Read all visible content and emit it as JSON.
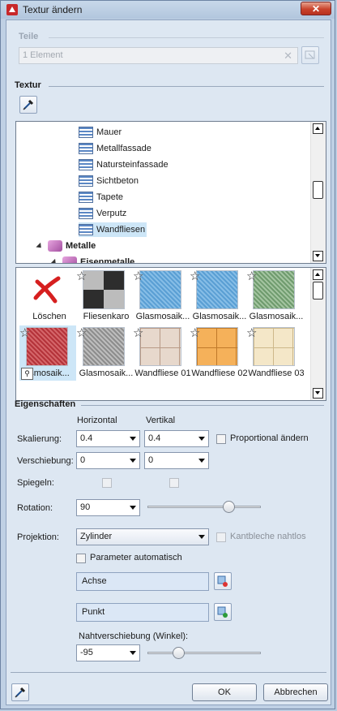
{
  "window": {
    "title": "Textur ändern",
    "close_label": "✕"
  },
  "teile": {
    "heading": "Teile",
    "input_value": "1 Element"
  },
  "textur": {
    "heading": "Textur",
    "tree": [
      {
        "label": "Mauer",
        "kind": "texture"
      },
      {
        "label": "Metallfassade",
        "kind": "texture"
      },
      {
        "label": "Natursteinfassade",
        "kind": "texture"
      },
      {
        "label": "Sichtbeton",
        "kind": "texture"
      },
      {
        "label": "Tapete",
        "kind": "texture"
      },
      {
        "label": "Verputz",
        "kind": "texture"
      },
      {
        "label": "Wandfliesen",
        "kind": "texture",
        "selected": true
      },
      {
        "label": "Metalle",
        "kind": "folder",
        "bold": true
      },
      {
        "label": "Eisenmetalle",
        "kind": "folder",
        "bold": true
      }
    ],
    "gallery": [
      {
        "caption": "Löschen",
        "kind": "delete"
      },
      {
        "caption": "Fliesenkaro",
        "kind": "checker"
      },
      {
        "caption": "Glasmosaik...",
        "kind": "blue"
      },
      {
        "caption": "Glasmosaik...",
        "kind": "blue"
      },
      {
        "caption": "Glasmosaik...",
        "kind": "green"
      },
      {
        "caption": "smosaik...",
        "kind": "red",
        "selected": true
      },
      {
        "caption": "Glasmosaik...",
        "kind": "grey"
      },
      {
        "caption": "Wandfliese 01",
        "kind": "beige"
      },
      {
        "caption": "Wandfliese 02",
        "kind": "orange"
      },
      {
        "caption": "Wandfliese 03",
        "kind": "cream"
      }
    ]
  },
  "eigenschaften": {
    "heading": "Eigenschaften",
    "col_horizontal": "Horizontal",
    "col_vertikal": "Vertikal",
    "skalierung_label": "Skalierung:",
    "skalierung_h": "0.4",
    "skalierung_v": "0.4",
    "proportional_label": "Proportional ändern",
    "verschiebung_label": "Verschiebung:",
    "verschiebung_h": "0",
    "verschiebung_v": "0",
    "spiegeln_label": "Spiegeln:",
    "rotation_label": "Rotation:",
    "rotation_value": "90",
    "projektion_label": "Projektion:",
    "projektion_value": "Zylinder",
    "kantbleche_label": "Kantbleche nahtlos",
    "parameter_label": "Parameter automatisch",
    "achse_value": "Achse",
    "punkt_value": "Punkt",
    "naht_label": "Nahtverschiebung (Winkel):",
    "naht_value": "-95"
  },
  "buttons": {
    "ok": "OK",
    "abbrechen": "Abbrechen"
  }
}
